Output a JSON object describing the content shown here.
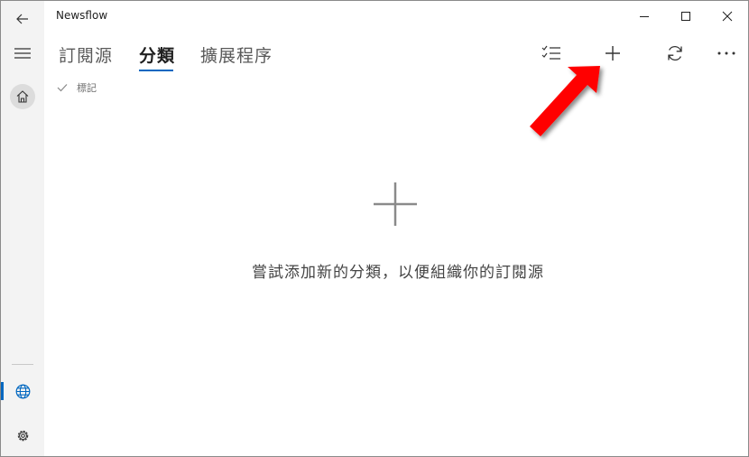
{
  "window": {
    "title": "Newsflow"
  },
  "tabs": [
    {
      "label": "訂閱源"
    },
    {
      "label": "分類"
    },
    {
      "label": "擴展程序"
    }
  ],
  "filter": {
    "label": "標記"
  },
  "empty_state": {
    "message": "嘗試添加新的分類，以便組織你的訂閱源"
  },
  "colors": {
    "accent": "#0067c0",
    "annotation_arrow": "#ff0000"
  },
  "icons": {
    "back": "back-arrow-icon",
    "menu": "hamburger-icon",
    "home": "home-icon",
    "globe": "globe-icon",
    "settings": "gear-icon",
    "select": "checklist-icon",
    "add": "plus-icon",
    "refresh": "refresh-icon",
    "more": "ellipsis-icon"
  }
}
